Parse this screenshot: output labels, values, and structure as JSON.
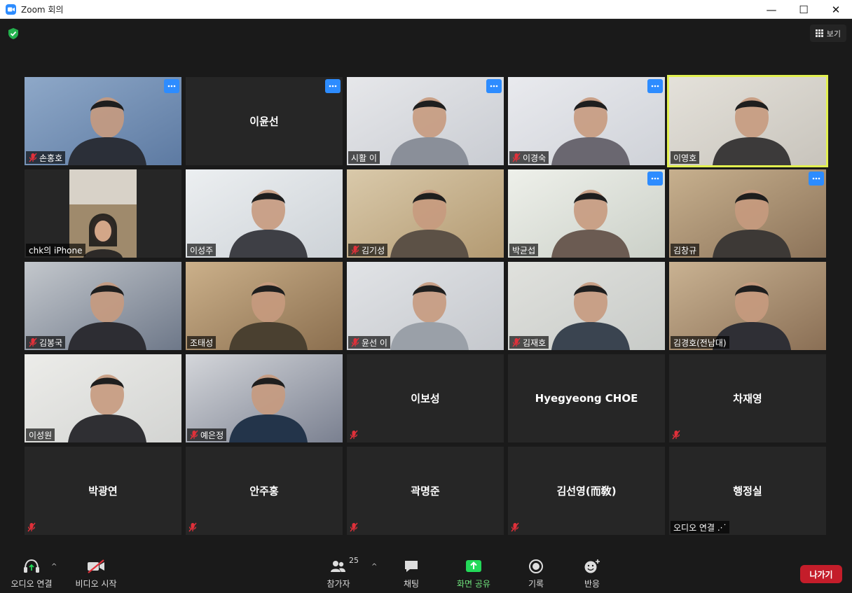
{
  "window": {
    "title": "Zoom 회의",
    "minimize": "—",
    "maximize": "☐",
    "close": "✕"
  },
  "header": {
    "view_label": "보기"
  },
  "participants": [
    {
      "name": "손홍호",
      "muted": true,
      "video": true,
      "more": true,
      "tag": true
    },
    {
      "name": "이윤선",
      "muted": false,
      "video": false,
      "more": true,
      "tag": false
    },
    {
      "name": "시활 이",
      "muted": false,
      "video": true,
      "more": true,
      "tag": true
    },
    {
      "name": "이경숙",
      "muted": true,
      "video": true,
      "more": true,
      "tag": true
    },
    {
      "name": "이영호",
      "muted": false,
      "video": true,
      "more": false,
      "tag": true,
      "active": true
    },
    {
      "name": "chk의 iPhone",
      "muted": false,
      "video": true,
      "more": false,
      "tag": true
    },
    {
      "name": "이성주",
      "muted": false,
      "video": true,
      "more": false,
      "tag": true
    },
    {
      "name": "김기성",
      "muted": true,
      "video": true,
      "more": false,
      "tag": true
    },
    {
      "name": "박균섭",
      "muted": false,
      "video": true,
      "more": true,
      "tag": true
    },
    {
      "name": "김창규",
      "muted": false,
      "video": true,
      "more": true,
      "tag": true
    },
    {
      "name": "김봉국",
      "muted": true,
      "video": true,
      "more": false,
      "tag": true
    },
    {
      "name": "조태성",
      "muted": false,
      "video": true,
      "more": false,
      "tag": true
    },
    {
      "name": "윤선 이",
      "muted": true,
      "video": true,
      "more": false,
      "tag": true
    },
    {
      "name": "김재호",
      "muted": true,
      "video": true,
      "more": false,
      "tag": true
    },
    {
      "name": "김경호(전남대)",
      "muted": false,
      "video": true,
      "more": false,
      "tag": true
    },
    {
      "name": "이성원",
      "muted": false,
      "video": true,
      "more": false,
      "tag": true
    },
    {
      "name": "예은정",
      "muted": true,
      "video": true,
      "more": false,
      "tag": true
    },
    {
      "name": "이보성",
      "muted": true,
      "video": false,
      "more": false,
      "tag": false
    },
    {
      "name": "Hyegyeong CHOE",
      "muted": false,
      "video": false,
      "more": false,
      "tag": false
    },
    {
      "name": "차재영",
      "muted": true,
      "video": false,
      "more": false,
      "tag": false
    },
    {
      "name": "박광연",
      "muted": true,
      "video": false,
      "more": false,
      "tag": false
    },
    {
      "name": "안주홍",
      "muted": true,
      "video": false,
      "more": false,
      "tag": false
    },
    {
      "name": "곽명준",
      "muted": true,
      "video": false,
      "more": false,
      "tag": false
    },
    {
      "name": "김선영(而敎)",
      "muted": true,
      "video": false,
      "more": false,
      "tag": false
    },
    {
      "name": "행정실",
      "muted": false,
      "video": false,
      "more": false,
      "tag": false,
      "audio_connecting": "오디오 연결 .·˙"
    }
  ],
  "toolbar": {
    "audio_label": "오디오 연결",
    "video_label": "비디오 시작",
    "participants_label": "참가자",
    "participants_count": "25",
    "chat_label": "채팅",
    "share_label": "화면 공유",
    "record_label": "기록",
    "reactions_label": "반응",
    "leave_label": "나가기",
    "caret": "^"
  },
  "colors": {
    "accent": "#2d8cff",
    "share_green": "#23d959",
    "leave_red": "#c41d2a",
    "active_speaker": "#e2f050",
    "muted_red": "#e0303a"
  }
}
